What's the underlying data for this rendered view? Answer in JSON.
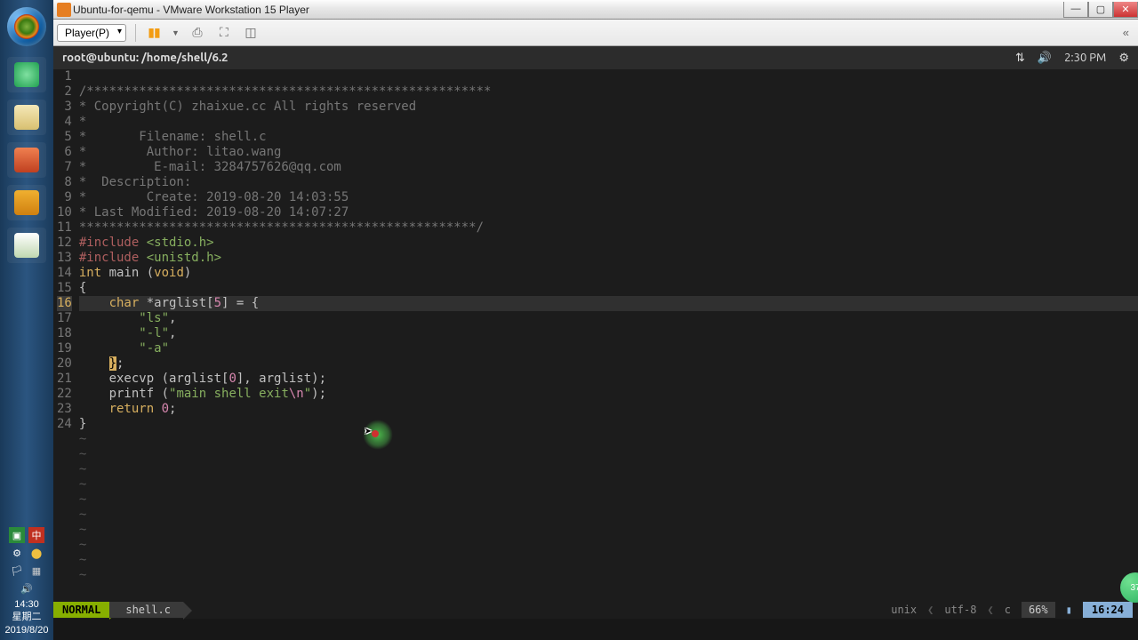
{
  "window": {
    "title": "Ubuntu-for-qemu - VMware Workstation 15 Player",
    "minimize": "—",
    "maximize": "▢",
    "close": "✕"
  },
  "vmware_toolbar": {
    "player_label": "Player(P)"
  },
  "win7": {
    "tray_time": "14:30",
    "tray_day": "星期二",
    "tray_date": "2019/8/20"
  },
  "ubuntu": {
    "title": "root@ubuntu: /home/shell/6.2",
    "time": "2:30 PM"
  },
  "code": {
    "lines": [
      {
        "n": 1,
        "segs": []
      },
      {
        "n": 2,
        "segs": [
          {
            "c": "comment",
            "t": "/******************************************************"
          }
        ]
      },
      {
        "n": 3,
        "segs": [
          {
            "c": "comment",
            "t": "* Copyright(C) zhaixue.cc All rights reserved"
          }
        ]
      },
      {
        "n": 4,
        "segs": [
          {
            "c": "comment",
            "t": "*"
          }
        ]
      },
      {
        "n": 5,
        "segs": [
          {
            "c": "comment",
            "t": "*       Filename: shell.c"
          }
        ]
      },
      {
        "n": 6,
        "segs": [
          {
            "c": "comment",
            "t": "*        Author: litao.wang"
          }
        ]
      },
      {
        "n": 7,
        "segs": [
          {
            "c": "comment",
            "t": "*         E-mail: 3284757626@qq.com"
          }
        ]
      },
      {
        "n": 8,
        "segs": [
          {
            "c": "comment",
            "t": "*  Description:"
          }
        ]
      },
      {
        "n": 9,
        "segs": [
          {
            "c": "comment",
            "t": "*        Create: 2019-08-20 14:03:55"
          }
        ]
      },
      {
        "n": 10,
        "segs": [
          {
            "c": "comment",
            "t": "* Last Modified: 2019-08-20 14:07:27"
          }
        ]
      },
      {
        "n": 11,
        "segs": [
          {
            "c": "comment",
            "t": "*****************************************************/"
          }
        ]
      },
      {
        "n": 12,
        "segs": [
          {
            "c": "preproc",
            "t": "#include "
          },
          {
            "c": "string",
            "t": "<stdio.h>"
          }
        ]
      },
      {
        "n": 13,
        "segs": [
          {
            "c": "preproc",
            "t": "#include "
          },
          {
            "c": "string",
            "t": "<unistd.h>"
          }
        ]
      },
      {
        "n": 14,
        "segs": [
          {
            "c": "type",
            "t": "int"
          },
          {
            "c": "",
            "t": " main ("
          },
          {
            "c": "type",
            "t": "void"
          },
          {
            "c": "",
            "t": ")"
          }
        ]
      },
      {
        "n": 15,
        "segs": [
          {
            "c": "",
            "t": "{"
          }
        ]
      },
      {
        "n": 16,
        "segs": [
          {
            "c": "",
            "t": "    "
          },
          {
            "c": "type",
            "t": "char"
          },
          {
            "c": "",
            "t": " *arglist["
          },
          {
            "c": "number",
            "t": "5"
          },
          {
            "c": "",
            "t": "] = {"
          }
        ],
        "current": true
      },
      {
        "n": 17,
        "segs": [
          {
            "c": "",
            "t": "        "
          },
          {
            "c": "string",
            "t": "\"ls\""
          },
          {
            "c": "",
            "t": ","
          }
        ]
      },
      {
        "n": 18,
        "segs": [
          {
            "c": "",
            "t": "        "
          },
          {
            "c": "string",
            "t": "\"-l\""
          },
          {
            "c": "",
            "t": ","
          }
        ]
      },
      {
        "n": 19,
        "segs": [
          {
            "c": "",
            "t": "        "
          },
          {
            "c": "string",
            "t": "\"-a\""
          }
        ]
      },
      {
        "n": 20,
        "segs": [
          {
            "c": "",
            "t": "    "
          },
          {
            "c": "bracket-hl",
            "t": "}"
          },
          {
            "c": "",
            "t": ";"
          }
        ]
      },
      {
        "n": 21,
        "segs": [
          {
            "c": "",
            "t": "    execvp (arglist["
          },
          {
            "c": "number",
            "t": "0"
          },
          {
            "c": "",
            "t": "], arglist);"
          }
        ]
      },
      {
        "n": 22,
        "segs": [
          {
            "c": "",
            "t": "    printf ("
          },
          {
            "c": "string",
            "t": "\"main shell exit"
          },
          {
            "c": "escape",
            "t": "\\n"
          },
          {
            "c": "string",
            "t": "\""
          },
          {
            "c": "",
            "t": ");"
          }
        ]
      },
      {
        "n": 23,
        "segs": [
          {
            "c": "",
            "t": "    "
          },
          {
            "c": "keyword",
            "t": "return"
          },
          {
            "c": "",
            "t": " "
          },
          {
            "c": "number",
            "t": "0"
          },
          {
            "c": "",
            "t": ";"
          }
        ]
      },
      {
        "n": 24,
        "segs": [
          {
            "c": "",
            "t": "}"
          }
        ]
      }
    ],
    "tilde_rows": 10
  },
  "status": {
    "mode": "NORMAL",
    "file": "shell.c",
    "fformat": "unix",
    "encoding": "utf-8",
    "filetype": "c",
    "percent": "66%",
    "pos": "16:24"
  },
  "badge": {
    "text": "37"
  }
}
